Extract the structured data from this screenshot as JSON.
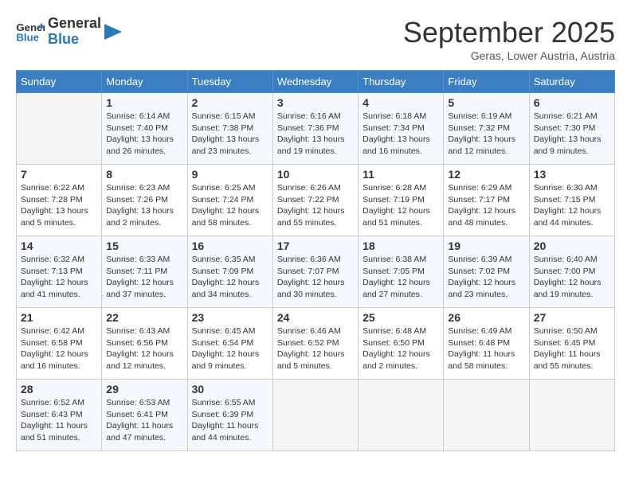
{
  "logo": {
    "text_general": "General",
    "text_blue": "Blue"
  },
  "header": {
    "month": "September 2025",
    "location": "Geras, Lower Austria, Austria"
  },
  "days_of_week": [
    "Sunday",
    "Monday",
    "Tuesday",
    "Wednesday",
    "Thursday",
    "Friday",
    "Saturday"
  ],
  "weeks": [
    [
      {
        "day": "",
        "info": ""
      },
      {
        "day": "1",
        "info": "Sunrise: 6:14 AM\nSunset: 7:40 PM\nDaylight: 13 hours\nand 26 minutes."
      },
      {
        "day": "2",
        "info": "Sunrise: 6:15 AM\nSunset: 7:38 PM\nDaylight: 13 hours\nand 23 minutes."
      },
      {
        "day": "3",
        "info": "Sunrise: 6:16 AM\nSunset: 7:36 PM\nDaylight: 13 hours\nand 19 minutes."
      },
      {
        "day": "4",
        "info": "Sunrise: 6:18 AM\nSunset: 7:34 PM\nDaylight: 13 hours\nand 16 minutes."
      },
      {
        "day": "5",
        "info": "Sunrise: 6:19 AM\nSunset: 7:32 PM\nDaylight: 13 hours\nand 12 minutes."
      },
      {
        "day": "6",
        "info": "Sunrise: 6:21 AM\nSunset: 7:30 PM\nDaylight: 13 hours\nand 9 minutes."
      }
    ],
    [
      {
        "day": "7",
        "info": "Sunrise: 6:22 AM\nSunset: 7:28 PM\nDaylight: 13 hours\nand 5 minutes."
      },
      {
        "day": "8",
        "info": "Sunrise: 6:23 AM\nSunset: 7:26 PM\nDaylight: 13 hours\nand 2 minutes."
      },
      {
        "day": "9",
        "info": "Sunrise: 6:25 AM\nSunset: 7:24 PM\nDaylight: 12 hours\nand 58 minutes."
      },
      {
        "day": "10",
        "info": "Sunrise: 6:26 AM\nSunset: 7:22 PM\nDaylight: 12 hours\nand 55 minutes."
      },
      {
        "day": "11",
        "info": "Sunrise: 6:28 AM\nSunset: 7:19 PM\nDaylight: 12 hours\nand 51 minutes."
      },
      {
        "day": "12",
        "info": "Sunrise: 6:29 AM\nSunset: 7:17 PM\nDaylight: 12 hours\nand 48 minutes."
      },
      {
        "day": "13",
        "info": "Sunrise: 6:30 AM\nSunset: 7:15 PM\nDaylight: 12 hours\nand 44 minutes."
      }
    ],
    [
      {
        "day": "14",
        "info": "Sunrise: 6:32 AM\nSunset: 7:13 PM\nDaylight: 12 hours\nand 41 minutes."
      },
      {
        "day": "15",
        "info": "Sunrise: 6:33 AM\nSunset: 7:11 PM\nDaylight: 12 hours\nand 37 minutes."
      },
      {
        "day": "16",
        "info": "Sunrise: 6:35 AM\nSunset: 7:09 PM\nDaylight: 12 hours\nand 34 minutes."
      },
      {
        "day": "17",
        "info": "Sunrise: 6:36 AM\nSunset: 7:07 PM\nDaylight: 12 hours\nand 30 minutes."
      },
      {
        "day": "18",
        "info": "Sunrise: 6:38 AM\nSunset: 7:05 PM\nDaylight: 12 hours\nand 27 minutes."
      },
      {
        "day": "19",
        "info": "Sunrise: 6:39 AM\nSunset: 7:02 PM\nDaylight: 12 hours\nand 23 minutes."
      },
      {
        "day": "20",
        "info": "Sunrise: 6:40 AM\nSunset: 7:00 PM\nDaylight: 12 hours\nand 19 minutes."
      }
    ],
    [
      {
        "day": "21",
        "info": "Sunrise: 6:42 AM\nSunset: 6:58 PM\nDaylight: 12 hours\nand 16 minutes."
      },
      {
        "day": "22",
        "info": "Sunrise: 6:43 AM\nSunset: 6:56 PM\nDaylight: 12 hours\nand 12 minutes."
      },
      {
        "day": "23",
        "info": "Sunrise: 6:45 AM\nSunset: 6:54 PM\nDaylight: 12 hours\nand 9 minutes."
      },
      {
        "day": "24",
        "info": "Sunrise: 6:46 AM\nSunset: 6:52 PM\nDaylight: 12 hours\nand 5 minutes."
      },
      {
        "day": "25",
        "info": "Sunrise: 6:48 AM\nSunset: 6:50 PM\nDaylight: 12 hours\nand 2 minutes."
      },
      {
        "day": "26",
        "info": "Sunrise: 6:49 AM\nSunset: 6:48 PM\nDaylight: 11 hours\nand 58 minutes."
      },
      {
        "day": "27",
        "info": "Sunrise: 6:50 AM\nSunset: 6:45 PM\nDaylight: 11 hours\nand 55 minutes."
      }
    ],
    [
      {
        "day": "28",
        "info": "Sunrise: 6:52 AM\nSunset: 6:43 PM\nDaylight: 11 hours\nand 51 minutes."
      },
      {
        "day": "29",
        "info": "Sunrise: 6:53 AM\nSunset: 6:41 PM\nDaylight: 11 hours\nand 47 minutes."
      },
      {
        "day": "30",
        "info": "Sunrise: 6:55 AM\nSunset: 6:39 PM\nDaylight: 11 hours\nand 44 minutes."
      },
      {
        "day": "",
        "info": ""
      },
      {
        "day": "",
        "info": ""
      },
      {
        "day": "",
        "info": ""
      },
      {
        "day": "",
        "info": ""
      }
    ]
  ]
}
